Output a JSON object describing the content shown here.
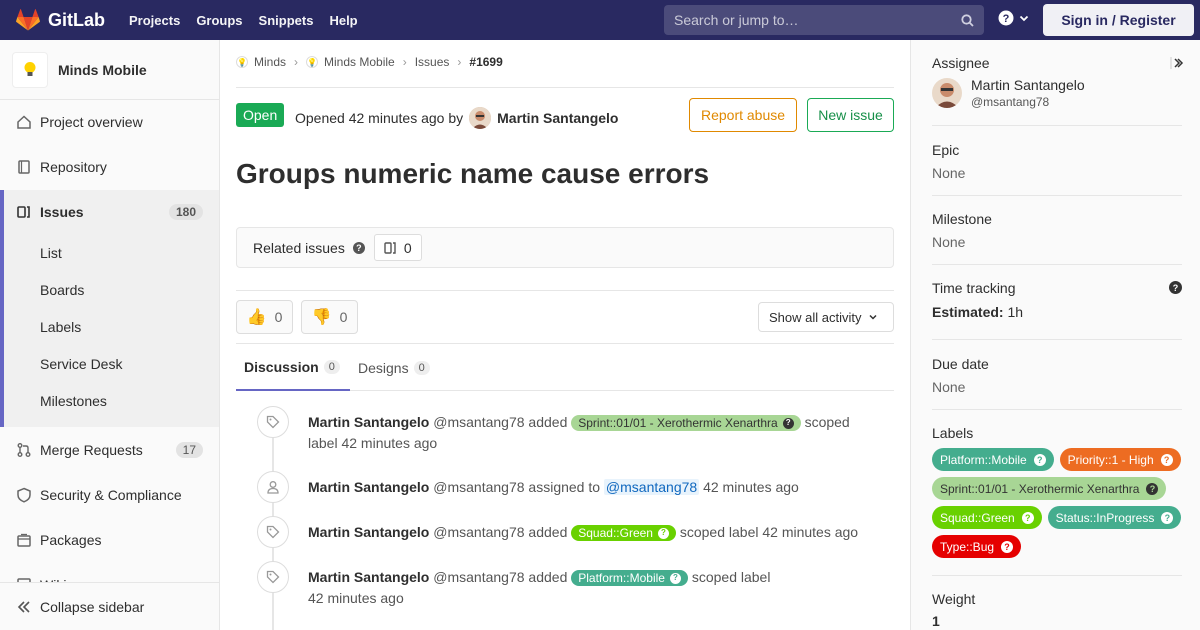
{
  "navbar": {
    "brand": "GitLab",
    "links": [
      "Projects",
      "Groups",
      "Snippets",
      "Help"
    ],
    "search_placeholder": "Search or jump to…",
    "sign_in": "Sign in / Register"
  },
  "sidebar": {
    "project_name": "Minds Mobile",
    "items": {
      "overview": "Project overview",
      "repository": "Repository",
      "issues": "Issues",
      "issues_count": "180",
      "merge_requests": "Merge Requests",
      "merge_requests_count": "17",
      "security": "Security & Compliance",
      "packages": "Packages",
      "wiki": "Wiki"
    },
    "issues_sub": [
      "List",
      "Boards",
      "Labels",
      "Service Desk",
      "Milestones"
    ],
    "collapse": "Collapse sidebar"
  },
  "breadcrumb": [
    "Minds",
    "Minds Mobile",
    "Issues",
    "#1699"
  ],
  "issue": {
    "status": "Open",
    "opened_text": "Opened 42 minutes ago by",
    "author": "Martin Santangelo",
    "report_abuse": "Report abuse",
    "new_issue": "New issue",
    "title": "Groups numeric name cause errors",
    "related_label": "Related issues",
    "related_count": "0",
    "thumbs_up_count": "0",
    "thumbs_down_count": "0",
    "activity_filter": "Show all activity",
    "tabs": {
      "discussion": "Discussion",
      "discussion_count": "0",
      "designs": "Designs",
      "designs_count": "0"
    }
  },
  "notes": [
    {
      "author": "Martin Santangelo",
      "handle": "@msantang78",
      "pre": "added",
      "label": "Sprint::01/01 - Xerothermic Xenarthra",
      "post": "scoped",
      "post2": "label 42 minutes ago"
    },
    {
      "author": "Martin Santangelo",
      "handle": "@msantang78",
      "pre": "assigned to",
      "mention": "@msantang78",
      "post": "42 minutes ago"
    },
    {
      "author": "Martin Santangelo",
      "handle": "@msantang78",
      "pre": "added",
      "label": "Squad::Green",
      "post": "scoped label 42 minutes ago"
    },
    {
      "author": "Martin Santangelo",
      "handle": "@msantang78",
      "pre": "added",
      "label": "Platform::Mobile",
      "post": "scoped label",
      "post2": "42 minutes ago"
    }
  ],
  "right_sidebar": {
    "assignee_title": "Assignee",
    "assignee_name": "Martin Santangelo",
    "assignee_handle": "@msantang78",
    "epic_title": "Epic",
    "epic_value": "None",
    "milestone_title": "Milestone",
    "milestone_value": "None",
    "time_title": "Time tracking",
    "estimated_label": "Estimated:",
    "estimated_value": "1h",
    "due_title": "Due date",
    "due_value": "None",
    "labels_title": "Labels",
    "labels": [
      {
        "text": "Platform::Mobile",
        "color": "#44ad8e"
      },
      {
        "text": "Priority::1 - High",
        "color": "#ed6c22"
      },
      {
        "text": "Sprint::01/01 - Xerothermic Xenarthra",
        "color": "#a8d695"
      },
      {
        "text": "Squad::Green",
        "color": "#69d100"
      },
      {
        "text": "Status::InProgress",
        "color": "#44ad8e"
      },
      {
        "text": "Type::Bug",
        "color": "#e50000"
      }
    ],
    "weight_title": "Weight",
    "weight_value": "1"
  },
  "colors": {
    "navbar": "#292961",
    "accent": "#6666c4",
    "open_status": "#1aaa55",
    "abuse": "#e08900"
  }
}
